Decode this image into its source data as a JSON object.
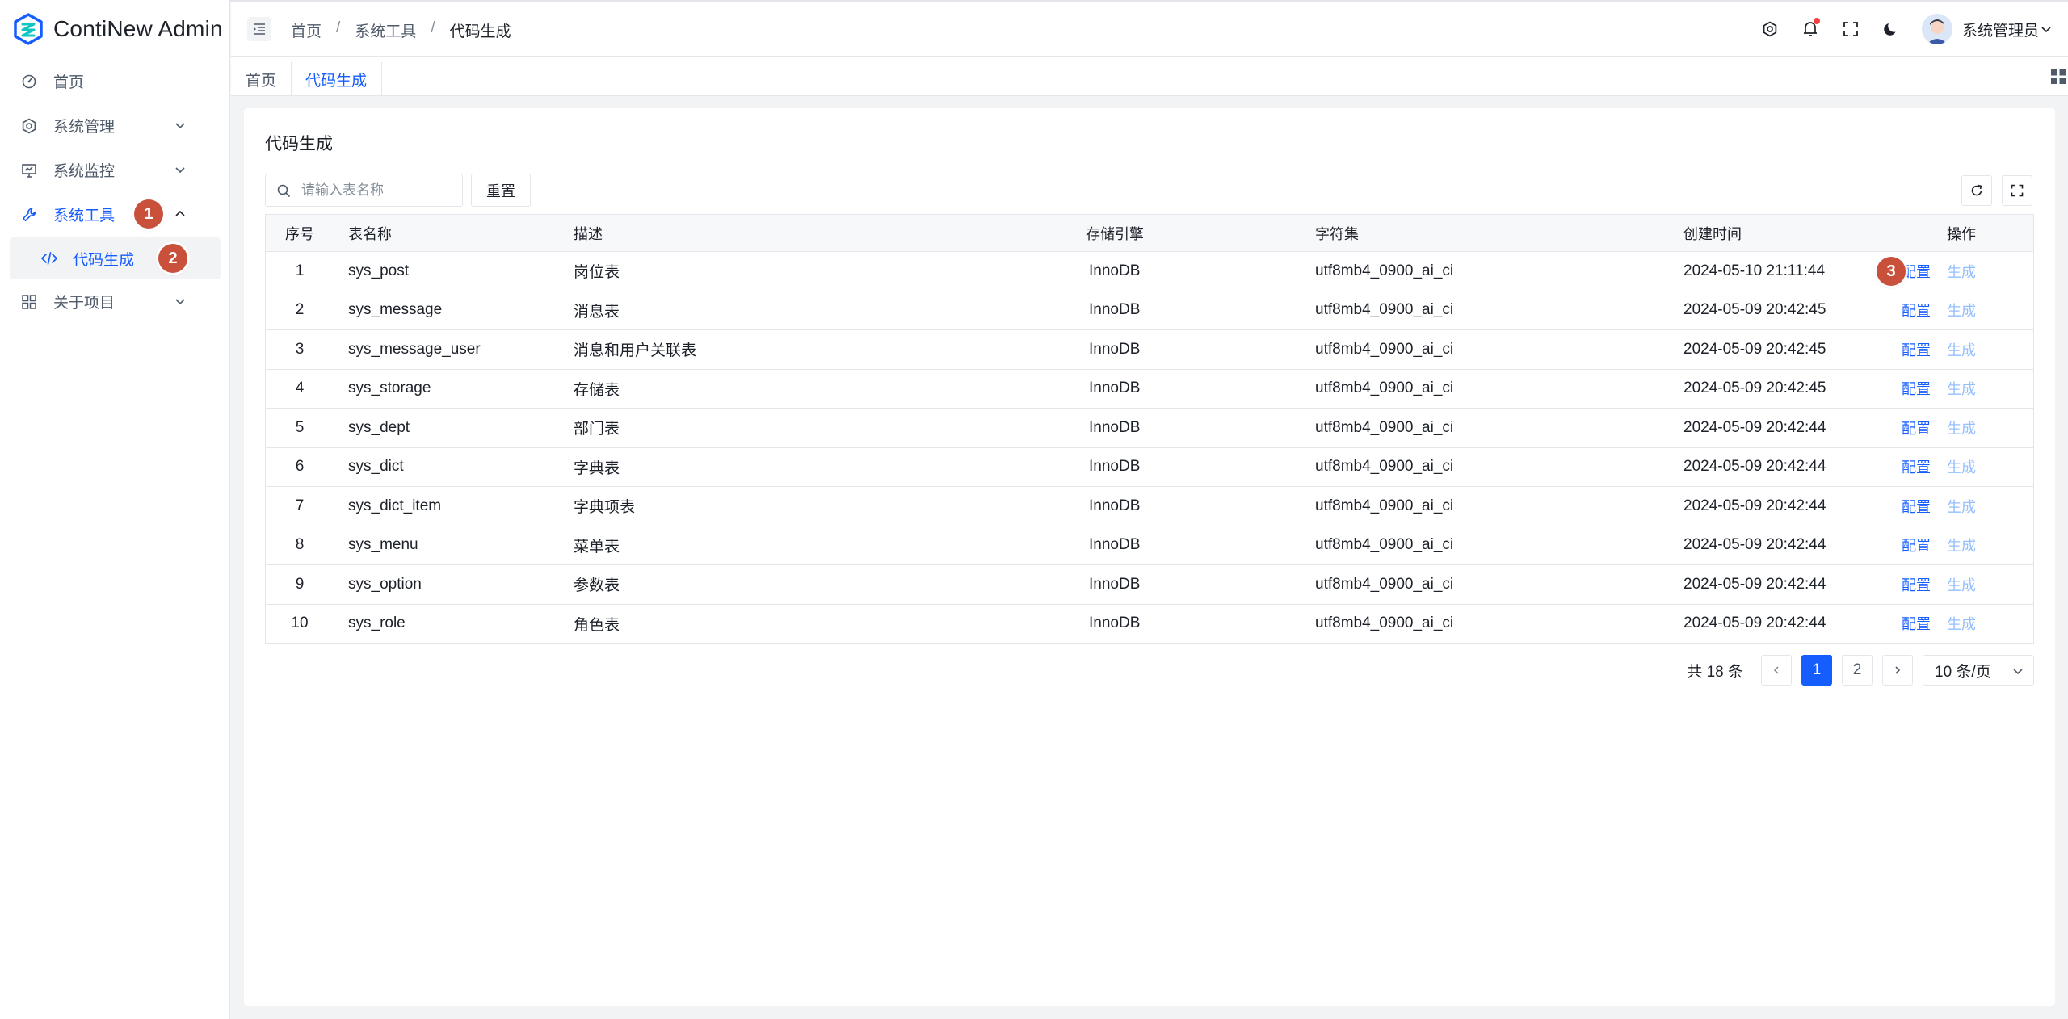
{
  "app": {
    "title": "ContiNew Admin"
  },
  "sidebar": {
    "items": [
      {
        "label": "首页",
        "icon": "dashboard-icon"
      },
      {
        "label": "系统管理",
        "icon": "gear-icon"
      },
      {
        "label": "系统监控",
        "icon": "monitor-icon"
      },
      {
        "label": "系统工具",
        "icon": "wrench-icon"
      },
      {
        "label": "关于项目",
        "icon": "apps-icon"
      }
    ],
    "sub_item": {
      "label": "代码生成",
      "icon": "code-icon"
    }
  },
  "header": {
    "breadcrumb": [
      "首页",
      "系统工具",
      "代码生成"
    ],
    "user_name": "系统管理员"
  },
  "tabs": [
    "首页",
    "代码生成"
  ],
  "page": {
    "title": "代码生成",
    "search_placeholder": "请输入表名称",
    "reset_label": "重置"
  },
  "table": {
    "columns": [
      "序号",
      "表名称",
      "描述",
      "存储引擎",
      "字符集",
      "创建时间",
      "操作"
    ],
    "rows": [
      {
        "idx": "1",
        "name": "sys_post",
        "desc": "岗位表",
        "engine": "InnoDB",
        "charset": "utf8mb4_0900_ai_ci",
        "time": "2024-05-10 21:11:44"
      },
      {
        "idx": "2",
        "name": "sys_message",
        "desc": "消息表",
        "engine": "InnoDB",
        "charset": "utf8mb4_0900_ai_ci",
        "time": "2024-05-09 20:42:45"
      },
      {
        "idx": "3",
        "name": "sys_message_user",
        "desc": "消息和用户关联表",
        "engine": "InnoDB",
        "charset": "utf8mb4_0900_ai_ci",
        "time": "2024-05-09 20:42:45"
      },
      {
        "idx": "4",
        "name": "sys_storage",
        "desc": "存储表",
        "engine": "InnoDB",
        "charset": "utf8mb4_0900_ai_ci",
        "time": "2024-05-09 20:42:45"
      },
      {
        "idx": "5",
        "name": "sys_dept",
        "desc": "部门表",
        "engine": "InnoDB",
        "charset": "utf8mb4_0900_ai_ci",
        "time": "2024-05-09 20:42:44"
      },
      {
        "idx": "6",
        "name": "sys_dict",
        "desc": "字典表",
        "engine": "InnoDB",
        "charset": "utf8mb4_0900_ai_ci",
        "time": "2024-05-09 20:42:44"
      },
      {
        "idx": "7",
        "name": "sys_dict_item",
        "desc": "字典项表",
        "engine": "InnoDB",
        "charset": "utf8mb4_0900_ai_ci",
        "time": "2024-05-09 20:42:44"
      },
      {
        "idx": "8",
        "name": "sys_menu",
        "desc": "菜单表",
        "engine": "InnoDB",
        "charset": "utf8mb4_0900_ai_ci",
        "time": "2024-05-09 20:42:44"
      },
      {
        "idx": "9",
        "name": "sys_option",
        "desc": "参数表",
        "engine": "InnoDB",
        "charset": "utf8mb4_0900_ai_ci",
        "time": "2024-05-09 20:42:44"
      },
      {
        "idx": "10",
        "name": "sys_role",
        "desc": "角色表",
        "engine": "InnoDB",
        "charset": "utf8mb4_0900_ai_ci",
        "time": "2024-05-09 20:42:44"
      }
    ],
    "actions": {
      "config": "配置",
      "generate": "生成"
    }
  },
  "pagination": {
    "total": "共 18 条",
    "pages": [
      "1",
      "2"
    ],
    "current": "1",
    "page_size": "10 条/页"
  },
  "annotations": [
    "1",
    "2",
    "3"
  ],
  "colors": {
    "primary": "#165dff",
    "disabled_link": "#94bfff",
    "badge": "#c9503a"
  }
}
